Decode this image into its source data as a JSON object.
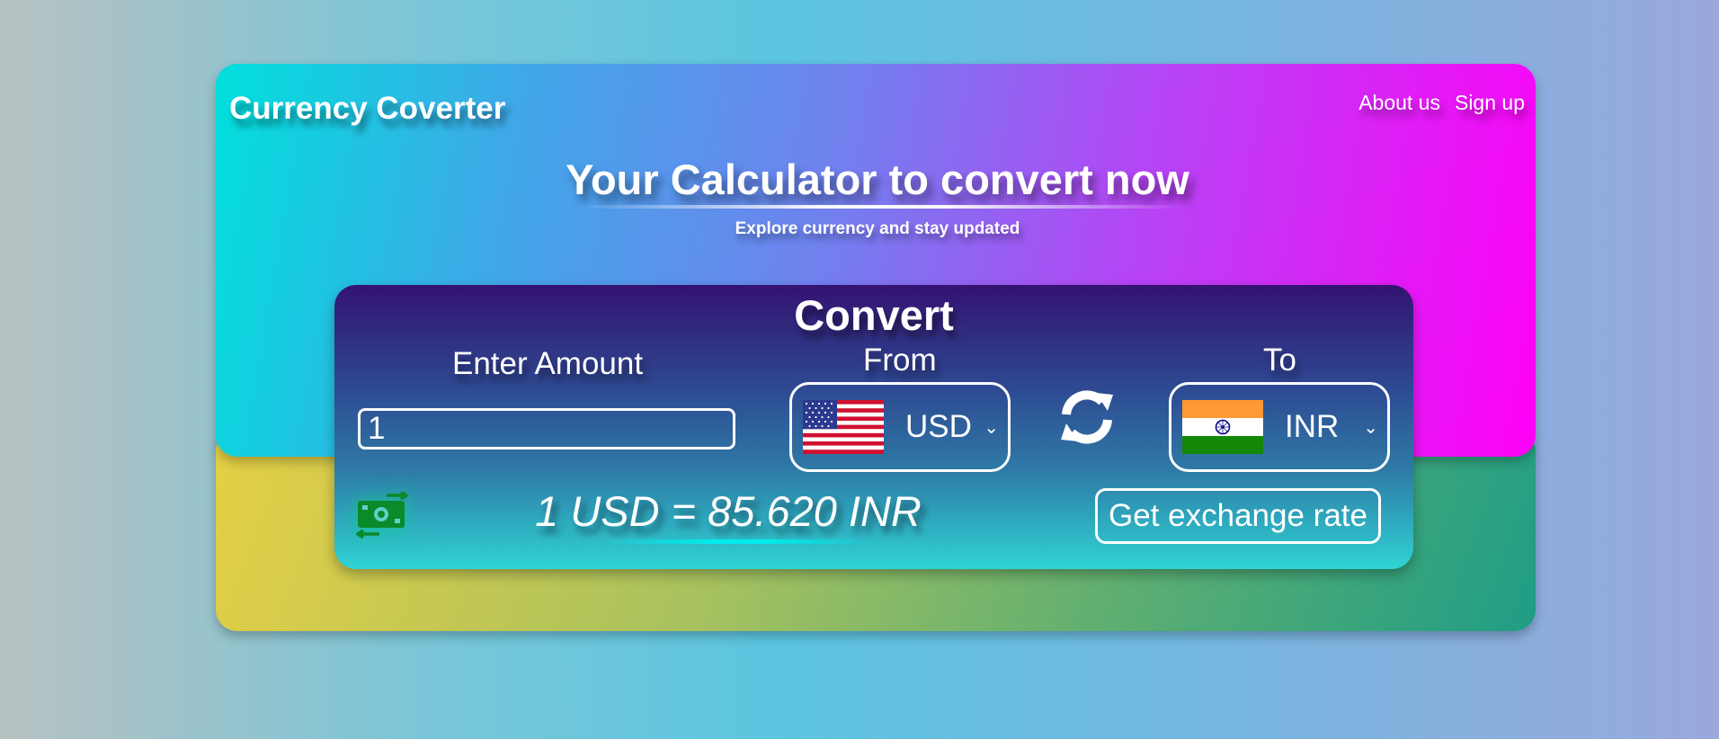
{
  "header": {
    "brand": "Currency Coverter",
    "nav": [
      "About us",
      "Sign up"
    ]
  },
  "hero": {
    "title": "Your Calculator to convert now",
    "subtitle": "Explore currency and stay updated"
  },
  "converter": {
    "title": "Convert",
    "amount_label": "Enter Amount",
    "amount_value": "1",
    "from_label": "From",
    "from_code": "USD",
    "to_label": "To",
    "to_code": "INR",
    "result": "1 USD = 85.620 INR",
    "button_label": "Get exchange rate"
  },
  "icons": {
    "swap": "swap-arrows-icon",
    "money": "money-exchange-icon",
    "chevron": "chevron-down-icon"
  },
  "colors": {
    "money_icon": "#0a8a2a",
    "rate_accent": "#00ebeb"
  }
}
